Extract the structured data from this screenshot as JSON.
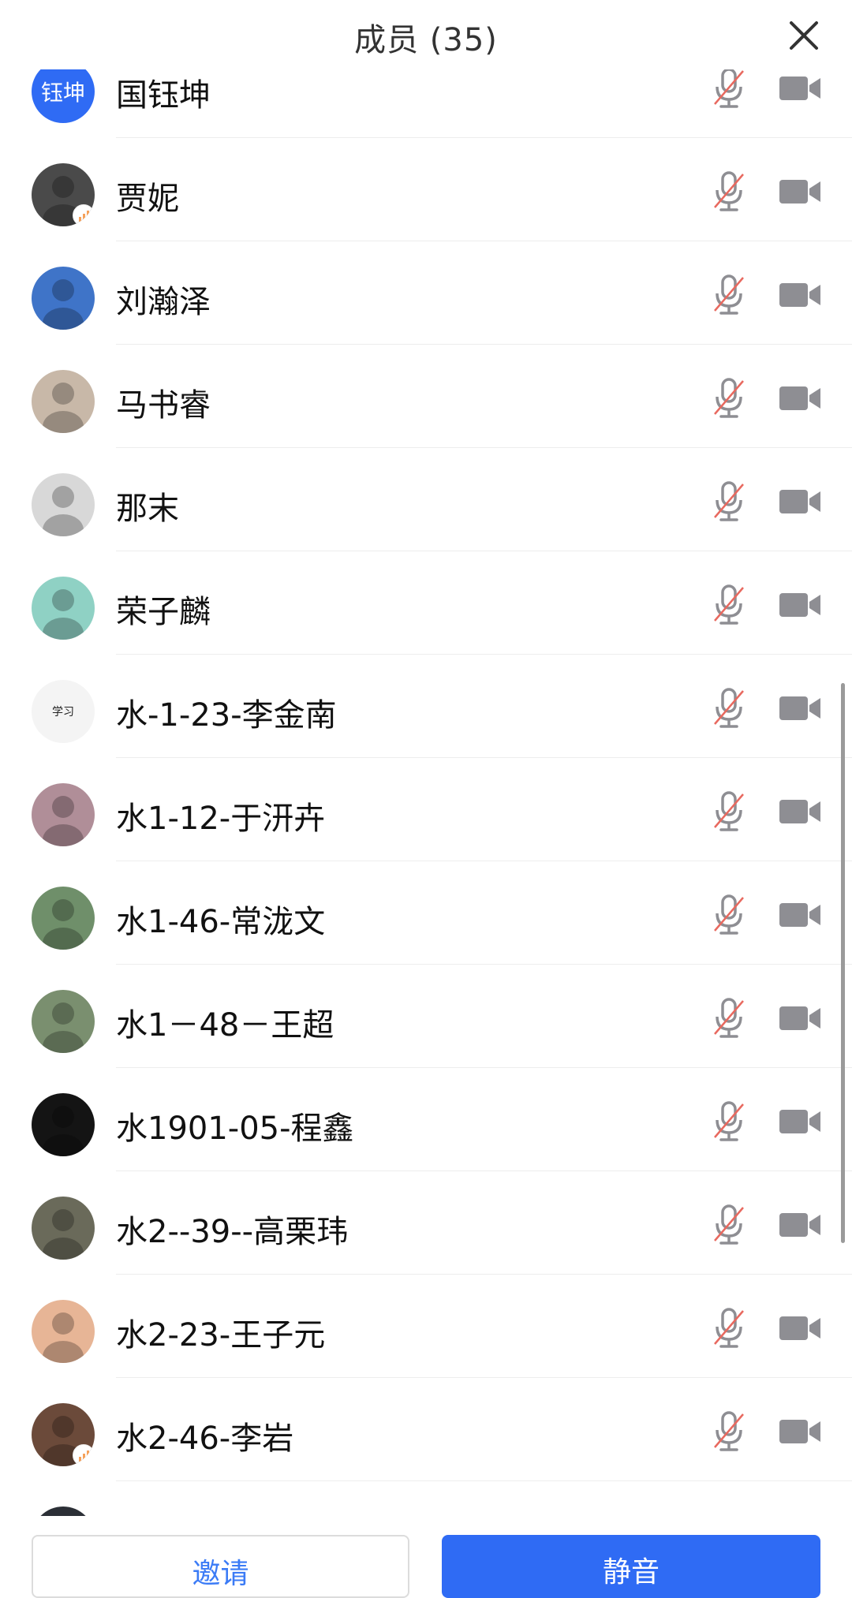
{
  "header": {
    "title": "成员 (35)",
    "close_icon": "close-icon"
  },
  "members": [
    {
      "name": "国钰坤",
      "avatar_text": "钰坤",
      "avatar_color": "#2f6bf4",
      "mic": "muted",
      "camera": "off"
    },
    {
      "name": "贾妮",
      "avatar_color": "#4a4a4a",
      "badge": "signal",
      "mic": "muted",
      "camera": "off"
    },
    {
      "name": "刘瀚泽",
      "avatar_color": "#3f74c8",
      "mic": "muted",
      "camera": "off"
    },
    {
      "name": "马书睿",
      "avatar_color": "#c8b8a8",
      "mic": "muted",
      "camera": "off"
    },
    {
      "name": "那末",
      "avatar_color": "#d8d8d8",
      "mic": "muted",
      "camera": "off"
    },
    {
      "name": "荣子麟",
      "avatar_color": "#8fd1c4",
      "mic": "muted",
      "camera": "off"
    },
    {
      "name": "水-1-23-李金南",
      "avatar_color": "#f4f4f4",
      "avatar_text": "学习",
      "mic": "muted",
      "camera": "off"
    },
    {
      "name": "水1-12-于汧卉",
      "avatar_color": "#b08e98",
      "mic": "muted",
      "camera": "off"
    },
    {
      "name": "水1-46-常泷文",
      "avatar_color": "#6f8f6a",
      "mic": "muted",
      "camera": "off"
    },
    {
      "name": "水1－48－王超",
      "avatar_color": "#7a8f6f",
      "mic": "muted",
      "camera": "off"
    },
    {
      "name": "水1901-05-程鑫",
      "avatar_color": "#141414",
      "mic": "muted",
      "camera": "off"
    },
    {
      "name": "水2--39--高栗玮",
      "avatar_color": "#6a6a5a",
      "mic": "muted",
      "camera": "off"
    },
    {
      "name": "水2-23-王子元",
      "avatar_color": "#e7b596",
      "mic": "muted",
      "camera": "off"
    },
    {
      "name": "水2-46-李岩",
      "avatar_color": "#6b4a3a",
      "badge": "signal",
      "mic": "muted",
      "camera": "off"
    }
  ],
  "footer": {
    "invite_label": "邀请",
    "mute_label": "静音"
  },
  "colors": {
    "accent": "#2f6bf4",
    "muted_mic_slash": "#e8695f",
    "icon_gray": "#8e8e93"
  }
}
